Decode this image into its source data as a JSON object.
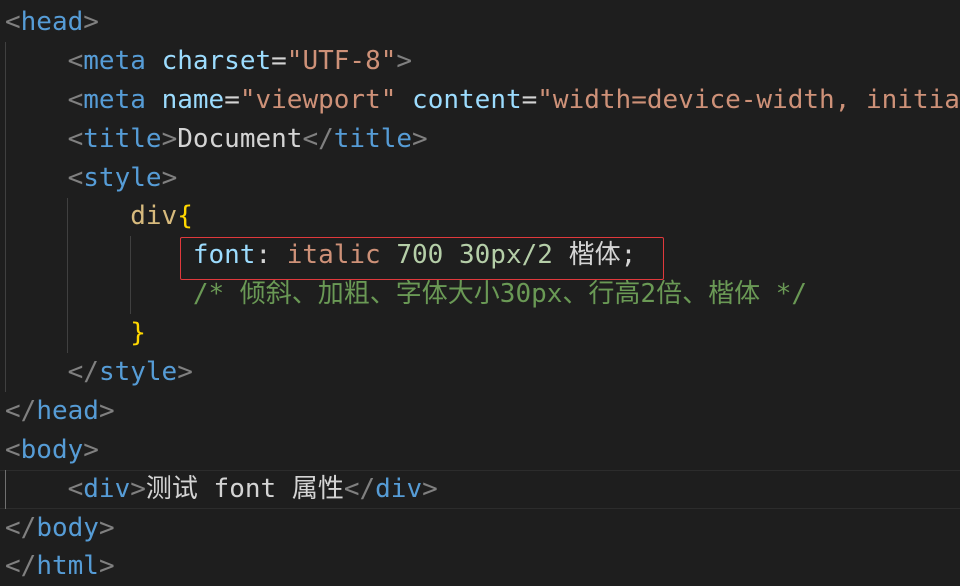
{
  "theme": {
    "bg": "#1e1e1e",
    "bracket": "#808080",
    "tag": "#569cd6",
    "attr": "#9cdcfe",
    "str": "#ce9178",
    "text": "#d4d4d4",
    "selector": "#d7ba7d",
    "brace": "#ffd700",
    "prop": "#9cdcfe",
    "val": "#ce9178",
    "num": "#b5cea8",
    "comment": "#6a9955",
    "guide": "#404040",
    "guide_active": "#707070",
    "current_line": "#2c2c2c",
    "highlight": "#e0393c"
  },
  "editor": {
    "highlighted_line": 7,
    "current_line": 13,
    "lines": [
      {
        "tokens": [
          {
            "t": "<",
            "k": "bracket"
          },
          {
            "t": "head",
            "k": "tag"
          },
          {
            "t": ">",
            "k": "bracket"
          }
        ]
      },
      {
        "tokens": [
          {
            "t": "    ",
            "k": "ws"
          },
          {
            "t": "<",
            "k": "bracket"
          },
          {
            "t": "meta",
            "k": "tag"
          },
          {
            "t": " ",
            "k": "text"
          },
          {
            "t": "charset",
            "k": "attr"
          },
          {
            "t": "=",
            "k": "text"
          },
          {
            "t": "\"UTF-8\"",
            "k": "str"
          },
          {
            "t": ">",
            "k": "bracket"
          }
        ]
      },
      {
        "tokens": [
          {
            "t": "    ",
            "k": "ws"
          },
          {
            "t": "<",
            "k": "bracket"
          },
          {
            "t": "meta",
            "k": "tag"
          },
          {
            "t": " ",
            "k": "text"
          },
          {
            "t": "name",
            "k": "attr"
          },
          {
            "t": "=",
            "k": "text"
          },
          {
            "t": "\"viewport\"",
            "k": "str"
          },
          {
            "t": " ",
            "k": "text"
          },
          {
            "t": "content",
            "k": "attr"
          },
          {
            "t": "=",
            "k": "text"
          },
          {
            "t": "\"width=device-width, initia",
            "k": "str"
          }
        ]
      },
      {
        "tokens": [
          {
            "t": "    ",
            "k": "ws"
          },
          {
            "t": "<",
            "k": "bracket"
          },
          {
            "t": "title",
            "k": "tag"
          },
          {
            "t": ">",
            "k": "bracket"
          },
          {
            "t": "Document",
            "k": "text"
          },
          {
            "t": "</",
            "k": "bracket"
          },
          {
            "t": "title",
            "k": "tag"
          },
          {
            "t": ">",
            "k": "bracket"
          }
        ]
      },
      {
        "tokens": [
          {
            "t": "    ",
            "k": "ws"
          },
          {
            "t": "<",
            "k": "bracket"
          },
          {
            "t": "style",
            "k": "tag"
          },
          {
            "t": ">",
            "k": "bracket"
          }
        ]
      },
      {
        "tokens": [
          {
            "t": "        ",
            "k": "ws"
          },
          {
            "t": "div",
            "k": "selector"
          },
          {
            "t": "{",
            "k": "brace"
          }
        ]
      },
      {
        "tokens": [
          {
            "t": "            ",
            "k": "ws"
          },
          {
            "t": "font",
            "k": "prop"
          },
          {
            "t": ":",
            "k": "text"
          },
          {
            "t": " ",
            "k": "text"
          },
          {
            "t": "italic",
            "k": "val"
          },
          {
            "t": " ",
            "k": "text"
          },
          {
            "t": "700",
            "k": "num"
          },
          {
            "t": " ",
            "k": "text"
          },
          {
            "t": "30px/2",
            "k": "num"
          },
          {
            "t": " ",
            "k": "text"
          },
          {
            "t": "楷体",
            "k": "text"
          },
          {
            "t": ";",
            "k": "text"
          }
        ]
      },
      {
        "tokens": [
          {
            "t": "            ",
            "k": "ws"
          },
          {
            "t": "/* 倾斜、加粗、字体大小30px、行高2倍、楷体 */",
            "k": "comment"
          }
        ]
      },
      {
        "tokens": [
          {
            "t": "        ",
            "k": "ws"
          },
          {
            "t": "}",
            "k": "brace"
          }
        ]
      },
      {
        "tokens": [
          {
            "t": "    ",
            "k": "ws"
          },
          {
            "t": "</",
            "k": "bracket"
          },
          {
            "t": "style",
            "k": "tag"
          },
          {
            "t": ">",
            "k": "bracket"
          }
        ]
      },
      {
        "tokens": [
          {
            "t": "</",
            "k": "bracket"
          },
          {
            "t": "head",
            "k": "tag"
          },
          {
            "t": ">",
            "k": "bracket"
          }
        ]
      },
      {
        "tokens": [
          {
            "t": "<",
            "k": "bracket"
          },
          {
            "t": "body",
            "k": "tag"
          },
          {
            "t": ">",
            "k": "bracket"
          }
        ]
      },
      {
        "tokens": [
          {
            "t": "    ",
            "k": "ws"
          },
          {
            "t": "<",
            "k": "bracket"
          },
          {
            "t": "div",
            "k": "tag"
          },
          {
            "t": ">",
            "k": "bracket"
          },
          {
            "t": "测试 font 属性",
            "k": "text"
          },
          {
            "t": "</",
            "k": "bracket"
          },
          {
            "t": "div",
            "k": "tag"
          },
          {
            "t": ">",
            "k": "bracket"
          }
        ]
      },
      {
        "tokens": [
          {
            "t": "</",
            "k": "bracket"
          },
          {
            "t": "body",
            "k": "tag"
          },
          {
            "t": ">",
            "k": "bracket"
          }
        ]
      },
      {
        "tokens": [
          {
            "t": "</",
            "k": "bracket"
          },
          {
            "t": "html",
            "k": "tag"
          },
          {
            "t": ">",
            "k": "bracket"
          }
        ]
      }
    ]
  }
}
